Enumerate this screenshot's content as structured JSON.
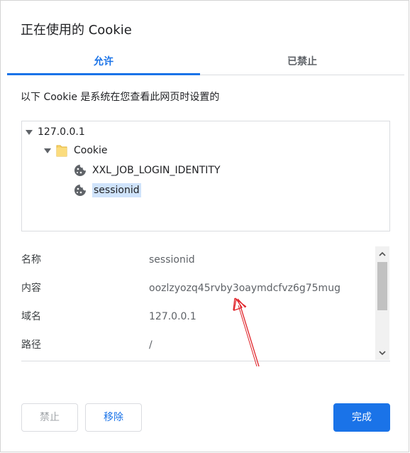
{
  "dialog": {
    "title": "正在使用的 Cookie"
  },
  "tabs": [
    {
      "label": "允许",
      "active": true
    },
    {
      "label": "已禁止",
      "active": false
    }
  ],
  "description": "以下 Cookie 是系统在您查看此网页时设置的",
  "tree": {
    "host": "127.0.0.1",
    "folder": "Cookie",
    "items": [
      {
        "label": "XXL_JOB_LOGIN_IDENTITY",
        "selected": false
      },
      {
        "label": "sessionid",
        "selected": true
      }
    ]
  },
  "details": [
    {
      "key": "名称",
      "value": "sessionid"
    },
    {
      "key": "内容",
      "value": "oozlzyozq45rvby3oaymdcfvz6g75mug"
    },
    {
      "key": "域名",
      "value": "127.0.0.1"
    },
    {
      "key": "路径",
      "value": "/"
    }
  ],
  "buttons": {
    "block": "禁止",
    "remove": "移除",
    "done": "完成"
  },
  "colors": {
    "accent": "#1a73e8",
    "selection": "#cfe3fb",
    "annotation_arrow": "#e0242a"
  },
  "icons": {
    "expand": "caret-down-icon",
    "folder": "folder-icon",
    "cookie": "cookie-icon",
    "scroll_up": "chevron-up-icon",
    "scroll_down": "chevron-down-icon"
  }
}
